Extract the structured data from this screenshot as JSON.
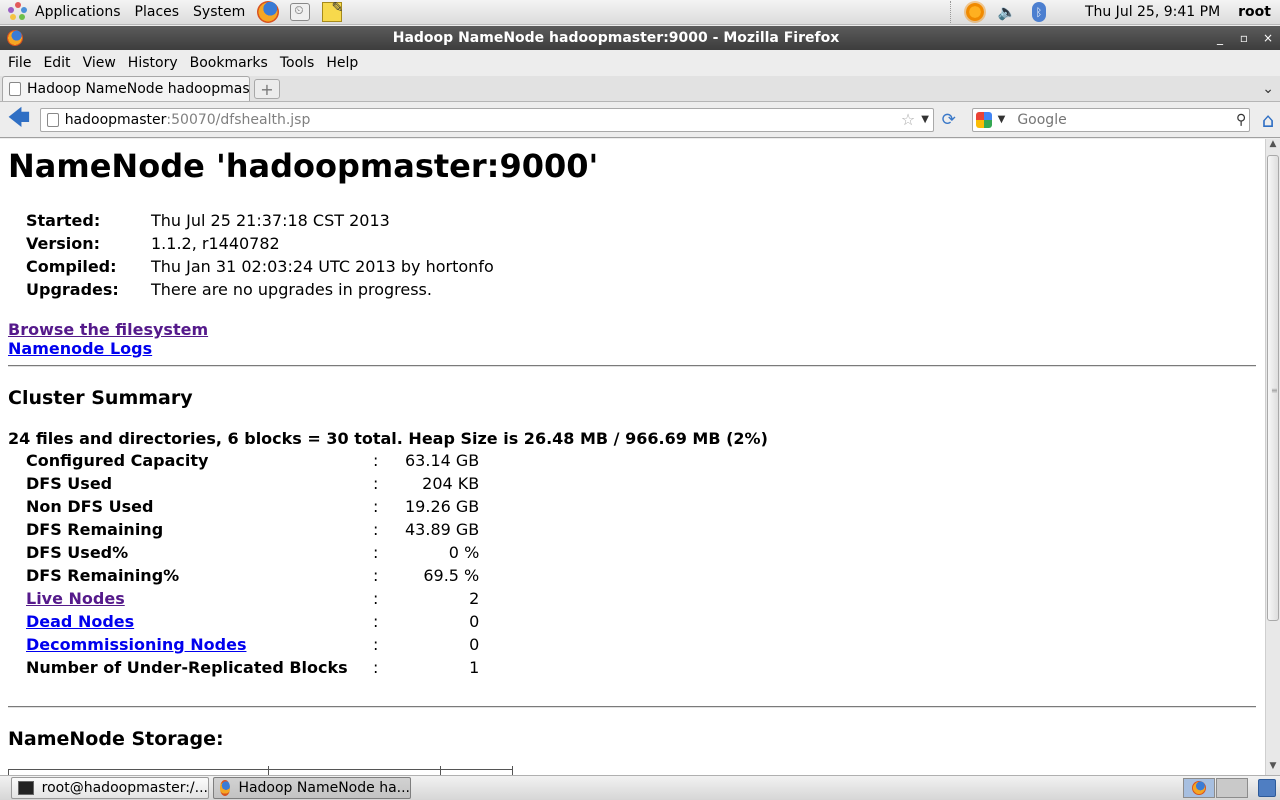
{
  "top_panel": {
    "menus": [
      "Applications",
      "Places",
      "System"
    ],
    "clock": "Thu Jul 25,  9:41 PM",
    "user": "root"
  },
  "window": {
    "title": "Hadoop NameNode hadoopmaster:9000 - Mozilla Firefox",
    "controls": [
      "_",
      "▫",
      "×"
    ]
  },
  "menubar": {
    "items": [
      {
        "label": "File"
      },
      {
        "label": "Edit"
      },
      {
        "label": "View"
      },
      {
        "label": "History"
      },
      {
        "label": "Bookmarks"
      },
      {
        "label": "Tools"
      },
      {
        "label": "Help"
      }
    ]
  },
  "tabs": {
    "active_label": "Hadoop NameNode hadoopmas...",
    "new_tab": "+",
    "list": "⌄"
  },
  "navbar": {
    "url_host": "hadoopmaster",
    "url_rest": ":50070/dfshealth.jsp",
    "search_placeholder": "Google"
  },
  "page": {
    "title": "NameNode 'hadoopmaster:9000'",
    "info": [
      {
        "key": "Started:",
        "value": "Thu Jul 25 21:37:18 CST 2013"
      },
      {
        "key": "Version:",
        "value": "1.1.2, r1440782"
      },
      {
        "key": "Compiled:",
        "value": "Thu Jan 31 02:03:24 UTC 2013 by hortonfo"
      },
      {
        "key": "Upgrades:",
        "value": "There are no upgrades in progress."
      }
    ],
    "links": {
      "browse": "Browse the filesystem",
      "logs": "Namenode Logs"
    },
    "cluster_summary_heading": "Cluster Summary",
    "summary_line": "24 files and directories, 6 blocks = 30 total. Heap Size is 26.48 MB / 966.69 MB (2%)",
    "summary": [
      {
        "key": "Configured Capacity",
        "value": "63.14 GB"
      },
      {
        "key": "DFS Used",
        "value": "204 KB"
      },
      {
        "key": "Non DFS Used",
        "value": "19.26 GB"
      },
      {
        "key": "DFS Remaining",
        "value": "43.89 GB"
      },
      {
        "key": "DFS Used%",
        "value": "0 %"
      },
      {
        "key": "DFS Remaining%",
        "value": "69.5 %"
      },
      {
        "key": "Live Nodes",
        "value": "2"
      },
      {
        "key": "Dead Nodes",
        "value": "0"
      },
      {
        "key": "Decommissioning Nodes",
        "value": "0"
      },
      {
        "key": "Number of Under-Replicated Blocks",
        "value": "1"
      }
    ],
    "separator": ":",
    "storage_heading": "NameNode Storage:"
  },
  "taskbar": {
    "tasks": [
      {
        "label": "root@hadoopmaster:/..."
      },
      {
        "label": "Hadoop NameNode ha..."
      }
    ]
  },
  "colors": {
    "link_visited": "#551a8b",
    "link_unvisited": "#0000ee",
    "titlebar": "#4a4a4a"
  }
}
